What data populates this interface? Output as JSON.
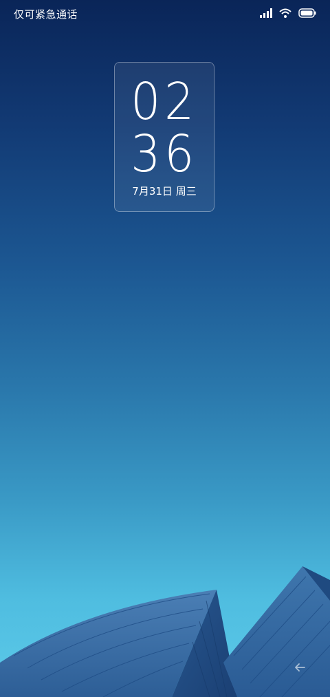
{
  "status_bar": {
    "carrier_text": "仅可紧急通话",
    "icons": [
      "signal-icon",
      "wifi-icon",
      "battery-icon"
    ]
  },
  "lock_clock": {
    "hours": "02",
    "minutes": "36",
    "date": "7月31日 周三"
  },
  "wallpaper": {
    "subject": "building-roof",
    "colors": {
      "top": "#0a2558",
      "middle": "#2a78ac",
      "bottom": "#5ccae9"
    }
  },
  "nav": {
    "back_icon": "back-arrow-icon"
  }
}
